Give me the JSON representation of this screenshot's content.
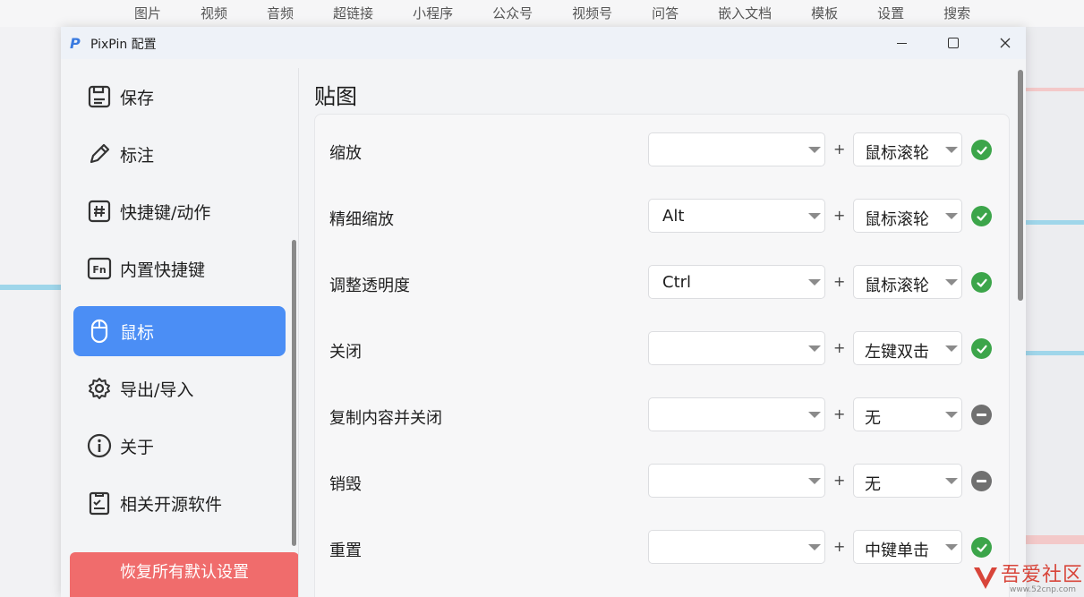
{
  "background": {
    "top_menu": [
      "图片",
      "视频",
      "音频",
      "超链接",
      "小程序",
      "公众号",
      "视频号",
      "问答",
      "嵌入文档",
      "模板",
      "设置",
      "搜索"
    ]
  },
  "window": {
    "title": "PixPin 配置",
    "logo_letter": "P"
  },
  "sidebar": {
    "items": [
      {
        "label": "保存",
        "icon": "save-icon"
      },
      {
        "label": "标注",
        "icon": "pencil-icon"
      },
      {
        "label": "快捷键/动作",
        "icon": "hash-icon"
      },
      {
        "label": "内置快捷键",
        "icon": "fn-key-icon"
      },
      {
        "label": "鼠标",
        "icon": "mouse-icon",
        "active": true
      },
      {
        "label": "导出/导入",
        "icon": "gear-icon"
      },
      {
        "label": "关于",
        "icon": "info-icon"
      },
      {
        "label": "相关开源软件",
        "icon": "checklist-icon"
      }
    ],
    "reset_label": "恢复所有默认设置"
  },
  "main": {
    "title": "贴图",
    "rows": [
      {
        "label": "缩放",
        "key": "",
        "mouse": "鼠标滚轮",
        "status": "ok"
      },
      {
        "label": "精细缩放",
        "key": "Alt",
        "mouse": "鼠标滚轮",
        "status": "ok"
      },
      {
        "label": "调整透明度",
        "key": "Ctrl",
        "mouse": "鼠标滚轮",
        "status": "ok"
      },
      {
        "label": "关闭",
        "key": "",
        "mouse": "左键双击",
        "status": "ok"
      },
      {
        "label": "复制内容并关闭",
        "key": "",
        "mouse": "无",
        "status": "none"
      },
      {
        "label": "销毁",
        "key": "",
        "mouse": "无",
        "status": "none"
      },
      {
        "label": "重置",
        "key": "",
        "mouse": "中键单击",
        "status": "ok"
      }
    ],
    "plus_sign": "+"
  },
  "watermark": {
    "text": "吾爱社区",
    "url": "www.52cnp.com"
  },
  "colors": {
    "accent": "#4b8ef5",
    "reset": "#f06c6c",
    "ok": "#3ca54a",
    "none": "#707070"
  }
}
